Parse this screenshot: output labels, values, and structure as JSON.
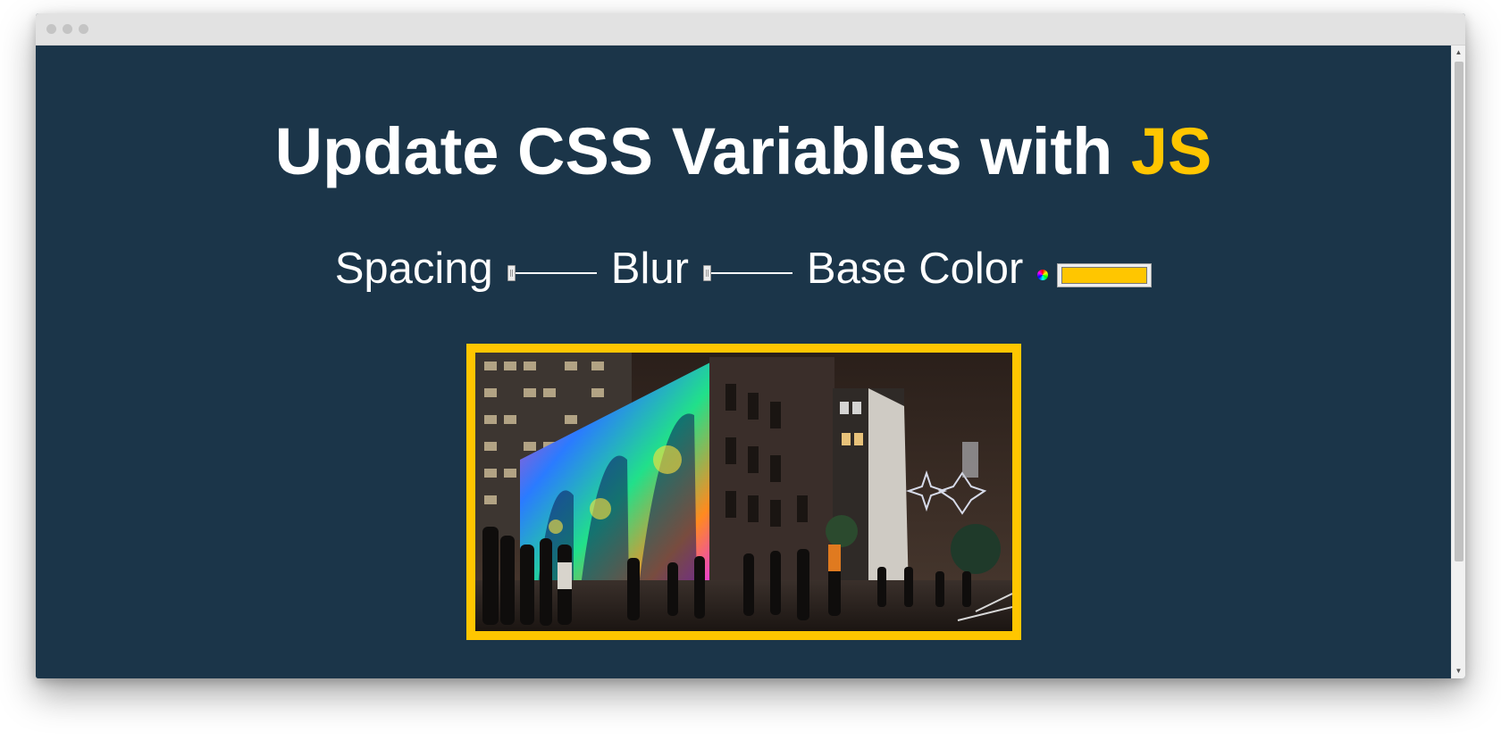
{
  "window": {
    "titlebar_buttons": [
      "close",
      "minimize",
      "zoom"
    ]
  },
  "header": {
    "title_main": "Update CSS Variables with ",
    "title_highlight": "JS"
  },
  "controls": {
    "spacing_label": "Spacing",
    "blur_label": "Blur",
    "base_color_label": "Base Color",
    "base_color_value": "#ffc600"
  },
  "image": {
    "description_icon": "photo-icon"
  },
  "colors": {
    "background": "#1b3549",
    "accent": "#ffc600",
    "text": "#ffffff"
  }
}
